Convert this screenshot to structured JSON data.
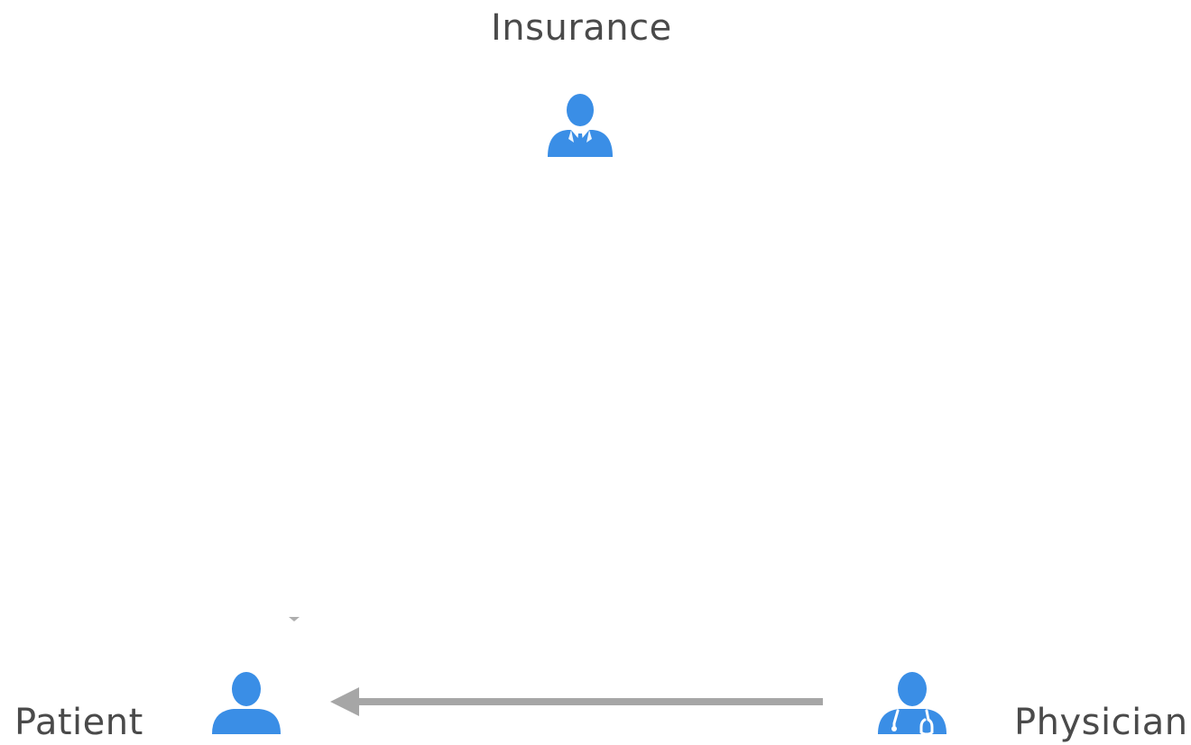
{
  "nodes": {
    "insurance": {
      "label": "Insurance",
      "icon": "businessman-icon"
    },
    "patient": {
      "label": "Patient",
      "icon": "person-icon"
    },
    "physician": {
      "label": "Physician",
      "icon": "doctor-icon"
    }
  },
  "edges": [
    {
      "from": "physician",
      "to": "patient",
      "label": ""
    }
  ],
  "colors": {
    "icon": "#3a8ee6",
    "arrow": "#a6a6a6",
    "text": "#4a4a4a",
    "background": "#ffffff"
  }
}
